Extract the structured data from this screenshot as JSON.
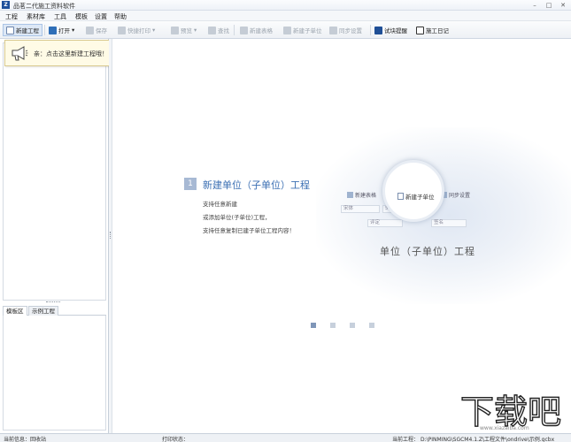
{
  "window": {
    "title": "品茗二代施工资料软件",
    "app_icon_letter": "Z",
    "controls": {
      "minimize": "–",
      "maximize": "□",
      "close": "✕"
    }
  },
  "menu": [
    "工程",
    "素材库",
    "工具",
    "模板",
    "设置",
    "帮助"
  ],
  "toolbar": {
    "new_project": "新建工程",
    "open": "打开",
    "save": "保存",
    "quick_print": "快捷打印",
    "preview": "预览",
    "find": "查找",
    "new_table": "新建表格",
    "new_sub_unit": "新建子单位",
    "sync_settings": "同步设置",
    "test_block_reminder": "试块提醒",
    "construction_log": "施工日记"
  },
  "left_panel": {
    "tree_root_toggle": "-",
    "tree_root_label": "工",
    "tabs": [
      "模板区",
      "示例工程"
    ]
  },
  "tooltip": {
    "text": "亲：点击这里新建工程哦！",
    "close": "×"
  },
  "guide": {
    "step_number": "1",
    "heading": "新建单位（子单位）工程",
    "lines": [
      "支持任意新建",
      "或添加单位(子单位)工程，",
      "支持任意复制已建子单位工程内容！"
    ],
    "preview": {
      "toolbar_items": [
        "新建表格",
        "新建子单位",
        "同步设置"
      ],
      "font_name": "宋体",
      "font_size": "5",
      "format_buttons": [
        "B",
        "I",
        "U"
      ],
      "row2_items": [
        "评定",
        "签名"
      ],
      "big_text": "单位（子单位）工程"
    },
    "carousel": {
      "count": 4,
      "active_index": 0
    }
  },
  "watermark": {
    "text": "下载吧",
    "url": "www.xiazaiba.com"
  },
  "status": {
    "info_label": "当前信息：",
    "info_value": "回收站",
    "print_label": "打印状态：",
    "project_label": "当前工程：",
    "project_path": "D:\\PINMING\\SGCM4.1.Z\\工程文件\\ondrive\\示例.gcbx"
  }
}
